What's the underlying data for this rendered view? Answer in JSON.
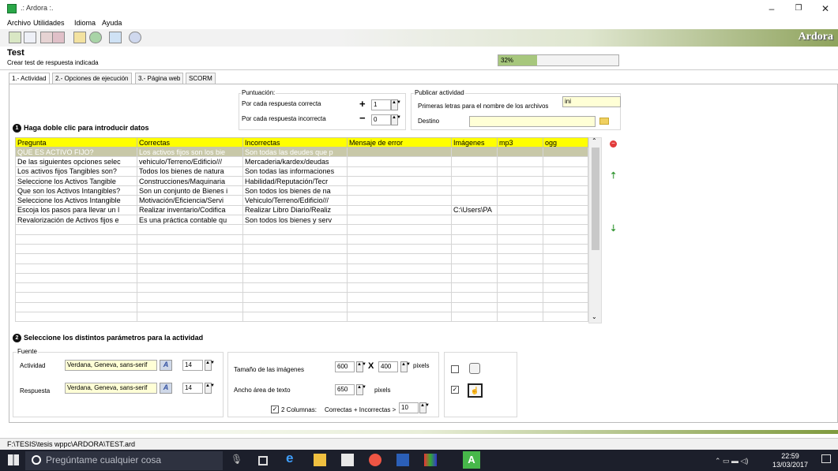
{
  "window": {
    "title": ".: Ardora :.",
    "minimize": "–",
    "maximize": "❐",
    "close": "✕"
  },
  "menu": [
    "Archivo",
    "Utilidades",
    "Idioma",
    "Ayuda"
  ],
  "brand": "Ardora",
  "header": {
    "title": "Test",
    "subtitle": "Crear test de respuesta indicada"
  },
  "progress": {
    "label": "32%",
    "value": 0.32
  },
  "tabs": [
    "1.- Actividad",
    "2.- Opciones de ejecución",
    "3.- Página web",
    "SCORM"
  ],
  "scoring": {
    "title": "Puntuación:",
    "correct_label": "Por cada respuesta correcta",
    "correct_sign": "+",
    "correct_value": "1",
    "incorrect_label": "Por cada respuesta incorrecta",
    "incorrect_sign": "−",
    "incorrect_value": "0"
  },
  "publish": {
    "title": "Publicar actividad",
    "prefix_label": "Primeras letras para el nombre de los archivos",
    "prefix_value": "ini",
    "dest_label": "Destino",
    "dest_value": ""
  },
  "step1": {
    "number": "1",
    "label": "Haga doble clic para introducir datos"
  },
  "grid": {
    "columns": [
      "Pregunta",
      "Correctas",
      "Incorrectas",
      "Mensaje de error",
      "Imágenes",
      "mp3",
      "ogg"
    ],
    "rows": [
      [
        "QUE ES ACTIVO FIJO?",
        "Los activos fijos son los bie",
        "Son todas las deudes que p",
        "",
        "",
        "",
        ""
      ],
      [
        "De las siguientes opciones selec",
        "vehiculo/Terreno/Edificio///",
        "Mercaderia/kardex/deudas",
        "",
        "",
        "",
        ""
      ],
      [
        "Los activos fijos Tangibles son?",
        "Todos los bienes de natura",
        "Son todas las informaciones",
        "",
        "",
        "",
        ""
      ],
      [
        "Seleccione los Activos Tangible",
        "Construcciones/Maquinaria",
        "Habilidad/Reputación/Tecr",
        "",
        "",
        "",
        ""
      ],
      [
        "Que son los Activos Intangibles?",
        "Son un conjunto de Bienes i",
        "Son todos los bienes de na",
        "",
        "",
        "",
        ""
      ],
      [
        "Seleccione los Activos Intangible",
        "Motivación/Eficiencia/Servi",
        "Vehiculo/Terreno/Edificio///",
        "",
        "",
        "",
        ""
      ],
      [
        "Escoja los pasos para llevar un l",
        "Realizar inventario/Codifica",
        "Realizar Libro Diario/Realiz",
        "",
        "C:\\Users\\PA",
        "",
        ""
      ],
      [
        "Revalorización de Activos fijos e",
        "Es  una práctica contable qu",
        "Son todos los bienes y serv",
        "",
        "",
        "",
        ""
      ],
      [
        "",
        "",
        "",
        "",
        "",
        "",
        ""
      ],
      [
        "",
        "",
        "",
        "",
        "",
        "",
        ""
      ],
      [
        "",
        "",
        "",
        "",
        "",
        "",
        ""
      ],
      [
        "",
        "",
        "",
        "",
        "",
        "",
        ""
      ],
      [
        "",
        "",
        "",
        "",
        "",
        "",
        ""
      ],
      [
        "",
        "",
        "",
        "",
        "",
        "",
        ""
      ],
      [
        "",
        "",
        "",
        "",
        "",
        "",
        ""
      ],
      [
        "",
        "",
        "",
        "",
        "",
        "",
        ""
      ],
      [
        "",
        "",
        "",
        "",
        "",
        "",
        ""
      ],
      [
        "",
        "",
        "",
        "",
        "",
        "",
        ""
      ]
    ]
  },
  "step2": {
    "number": "2",
    "label": "Seleccione los distintos parámetros para la actividad"
  },
  "font": {
    "title": "Fuente",
    "activity_label": "Actividad",
    "activity_font": "Verdana, Geneva, sans-serif",
    "activity_size": "14",
    "answer_label": "Respuesta",
    "answer_font": "Verdana, Geneva, sans-serif",
    "answer_size": "14"
  },
  "images": {
    "size_label": "Tamaño de las imágenes",
    "width": "600",
    "times": "X",
    "height": "400",
    "px1": "pixels",
    "textarea_label": "Ancho área de texto",
    "textarea_value": "650",
    "px2": "pixels",
    "two_cols_label": "2 Columnas:",
    "two_cols_expr": "Correctas + Incorrectas >",
    "two_cols_value": "10"
  },
  "status": {
    "path": "F:\\TESIS\\tesis wppc\\ARDORA\\TEST.ard"
  },
  "taskbar": {
    "search_placeholder": "Pregúntame cualquier cosa",
    "time": "22:59",
    "date": "13/03/2017"
  }
}
